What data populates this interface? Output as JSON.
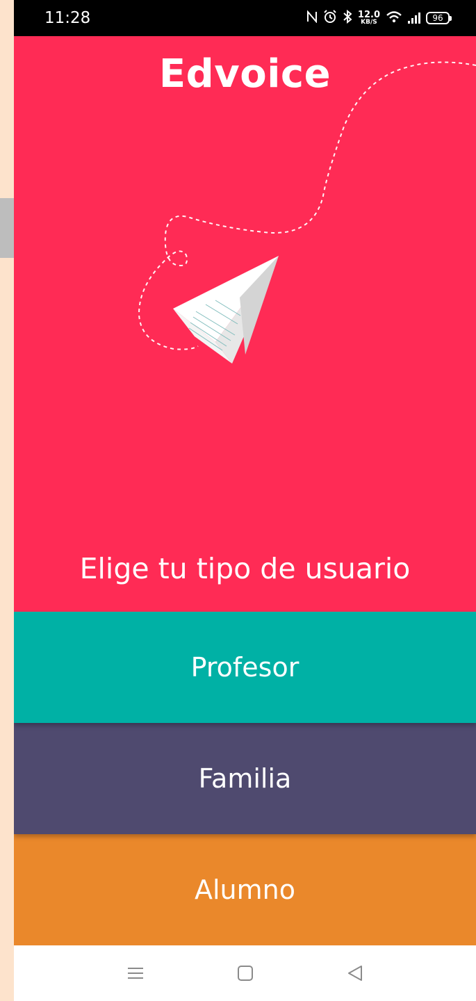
{
  "status_bar": {
    "time": "11:28",
    "speed_value": "12.0",
    "speed_unit": "KB/S",
    "battery": "96",
    "icons": [
      "nfc-icon",
      "alarm-icon",
      "bluetooth-icon",
      "wifi-icon",
      "signal-icon",
      "battery-icon"
    ]
  },
  "hero": {
    "app_title": "Edvoice",
    "illustration": "paper-plane-icon",
    "prompt": "Elige tu tipo de usuario",
    "background_color": "#ff2b55"
  },
  "user_types": [
    {
      "label": "Profesor",
      "color": "#00b1a5"
    },
    {
      "label": "Familia",
      "color": "#4f4a6f"
    },
    {
      "label": "Alumno",
      "color": "#ea882b"
    }
  ],
  "nav_bar": {
    "buttons": [
      "menu-icon",
      "home-icon",
      "back-icon"
    ]
  }
}
